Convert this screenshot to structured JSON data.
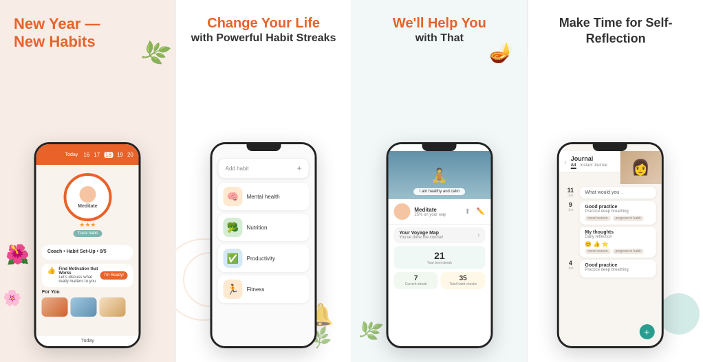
{
  "panel1": {
    "heading_line1": "New Year —",
    "heading_line2": "New Habits",
    "phone": {
      "dates": [
        "16",
        "17",
        "18",
        "19",
        "20"
      ],
      "today_label": "Today",
      "habit_name": "Meditate",
      "track_btn": "Track habit",
      "coach_label": "Coach • Habit Set-Up • 0/5",
      "find_title": "Find Motivation that Works",
      "find_sub": "Let's discuss what really matters to you",
      "ready_btn": "I'm Ready!",
      "for_you": "For You",
      "bottom_nav": "Today"
    }
  },
  "panel2": {
    "heading_main": "Change Your Life",
    "heading_sub": "with Powerful Habit Streaks",
    "phone": {
      "add_habit_placeholder": "Add habit",
      "add_habit_icon": "+",
      "habits": [
        {
          "icon": "🧠",
          "label": "Mental health",
          "icon_type": "orange"
        },
        {
          "icon": "🥦",
          "label": "Nutrition",
          "icon_type": "green"
        },
        {
          "icon": "✅",
          "label": "Productivity",
          "icon_type": "blue"
        },
        {
          "icon": "🏃",
          "label": "Fitness",
          "icon_type": "orange"
        }
      ]
    }
  },
  "panel3": {
    "heading_main": "We'll Help You",
    "heading_sub": "with That",
    "phone": {
      "hero_caption": "I am healthy and calm",
      "habit_name": "Meditate",
      "habit_progress": "25% on your way",
      "voyage_title": "Your Voyage Map",
      "voyage_sub": "You've done the course!",
      "streak_num": "21",
      "streak_label": "Your best streak",
      "current_streak_num": "7",
      "current_streak_label": "Current streak",
      "total_checks_num": "35",
      "total_checks_label": "Total habit checks"
    }
  },
  "panel4": {
    "heading": "Make Time for Self-Reflection",
    "phone": {
      "journal_title": "Journal",
      "tab_all": "All",
      "tab_instant": "Instant Journal",
      "date_top": "11",
      "month_top": "Jun",
      "question": "What would you",
      "date1": "9",
      "month1": "Jun",
      "entry1_title": "Good practice",
      "entry1_sub": "Practice deep breathing",
      "entry1_tags": [
        "mood reason",
        "progress in habit"
      ],
      "date2": "",
      "entry2_title": "My thoughts",
      "entry2_sub": "Daily reflection",
      "entry2_tags": [
        "mood reason",
        "progress in habit"
      ],
      "date3": "4",
      "month3": "Jun",
      "entry3_title": "Good practice",
      "entry3_sub": "Practice deep breathing",
      "add_btn": "+"
    }
  }
}
